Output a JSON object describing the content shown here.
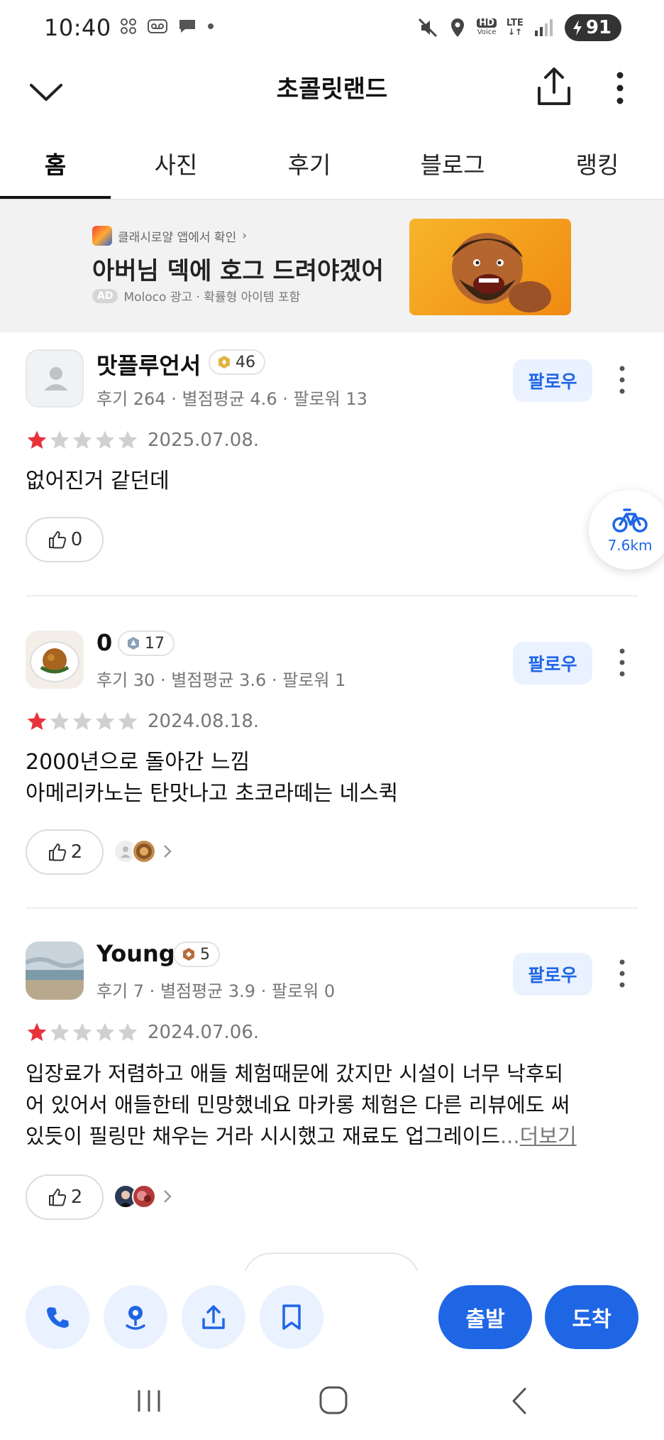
{
  "status_bar": {
    "time": "10:40",
    "battery": "91",
    "hd_voice_line1": "HD",
    "hd_voice_line2": "Voice",
    "lte": "LTE"
  },
  "header": {
    "title": "초콜릿랜드"
  },
  "tabs": [
    {
      "label": "홈",
      "active": true
    },
    {
      "label": "사진",
      "active": false
    },
    {
      "label": "후기",
      "active": false
    },
    {
      "label": "블로그",
      "active": false
    },
    {
      "label": "랭킹",
      "active": false
    }
  ],
  "ad": {
    "source": "클래시로얄 앱에서 확인",
    "source_chevron": "›",
    "headline": "아버님 덱에 호그 드려야겠어",
    "badge": "AD",
    "meta": "Moloco 광고 · 확률형 아이템 포함"
  },
  "reviews": [
    {
      "name": "맛플루언서",
      "level": "46",
      "stats": "후기 264 · 별점평균 4.6 · 팔로워 13",
      "follow": "팔로우",
      "rating": 1,
      "date": "2025.07.08.",
      "text_lines": [
        "없어진거 같던데"
      ],
      "likes": "0"
    },
    {
      "name": "0",
      "level": "17",
      "stats": "후기 30 · 별점평균 3.6 · 팔로워 1",
      "follow": "팔로우",
      "rating": 1,
      "date": "2024.08.18.",
      "text_lines": [
        "2000년으로 돌아간 느낌",
        "아메리카노는 탄맛나고 초코라떼는 네스퀵"
      ],
      "likes": "2"
    },
    {
      "name": "Young",
      "level": "5",
      "stats": "후기 7 · 별점평균 3.9 · 팔로워 0",
      "follow": "팔로우",
      "rating": 1,
      "date": "2024.07.06.",
      "text_lines": [
        "입장료가 저렴하고 애들 체험때문에 갔지만 시설이 너무 낙후되",
        "어 있어서 애들한테 민망했네요 마카롱 체험은 다른 리뷰에도 써",
        "있듯이 필링만 채우는 거라 시시했고 재료도 업그레이드"
      ],
      "ellipsis": "...",
      "more": "더보기",
      "likes": "2"
    }
  ],
  "floating": {
    "distance": "7.6km"
  },
  "bottom_bar": {
    "depart": "출발",
    "arrive": "도착"
  },
  "colors": {
    "accent": "#1f66e5",
    "accent_light": "#eaf1ff",
    "star_on": "#e8333a",
    "star_off": "#d0d0d0"
  }
}
